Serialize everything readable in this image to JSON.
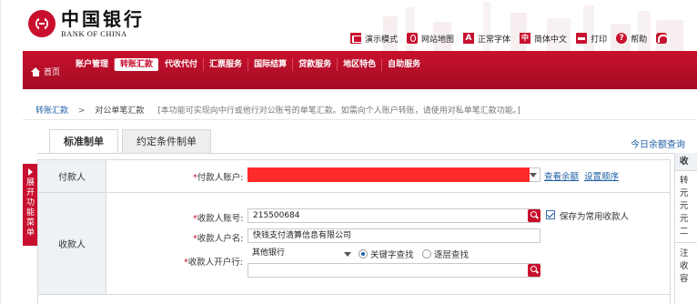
{
  "logo": {
    "cn": "中国银行",
    "en": "BANK OF CHINA"
  },
  "toolbar": {
    "present_mode": "演示模式",
    "site_map": "网站地图",
    "font_size": "正常字体",
    "font_icon": "A",
    "language": "简体中文",
    "lang_icon": "中",
    "print": "打印",
    "help": "帮助",
    "help_icon": "?"
  },
  "nav": {
    "home": "首页",
    "items": [
      "账户管理",
      "转账汇款",
      "代收代付",
      "汇票服务",
      "国际结算",
      "贷款服务",
      "地区特色",
      "自助服务"
    ],
    "active": "转账汇款"
  },
  "breadcrumb": {
    "parent": "转账汇款",
    "separator": ">",
    "current": "对公单笔汇款",
    "note": "[本功能可实现向中行或他行对公账号的单笔汇款。如需向个人账户转账，请使用对私单笔汇款功能。]"
  },
  "tabs": [
    "标准制单",
    "约定条件制单"
  ],
  "today_link": "今日余额查询",
  "side_expand": "展开功能菜单",
  "payer": {
    "section": "付款人",
    "account_label": "*付款人账户:",
    "check_balance": "查看余额",
    "set_order": "设置顺序"
  },
  "payee": {
    "section": "收款人",
    "account_label": "*收款人账号:",
    "account_value": "215500684",
    "save_label": "保存为常用收款人",
    "name_label": "*收款人户名:",
    "name_value": "快钱支付清算信息有限公司",
    "bank_label": "*收款人开户行:",
    "bank_select": "其他银行",
    "radio_keyword": "关键字查找",
    "radio_level": "逐层查找"
  },
  "right_panel": {
    "head": "收",
    "block1": "转元元元二",
    "block2": "注收容"
  },
  "colors": {
    "brand": "#c8102e",
    "link": "#1f5fa6",
    "label_bg": "#eef1f6"
  }
}
